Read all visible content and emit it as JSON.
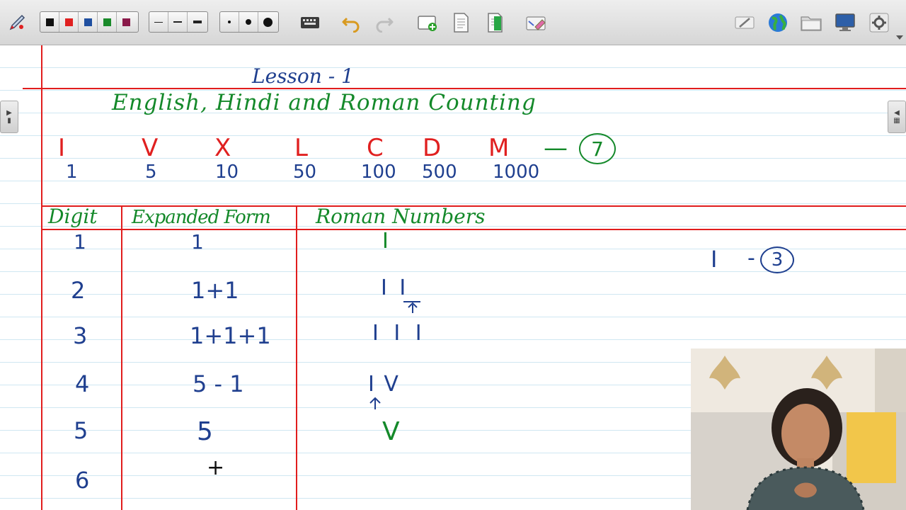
{
  "toolbar": {
    "colors": [
      "#111111",
      "#e02020",
      "#1f4fa0",
      "#1a8a2a",
      "#8a1a4a"
    ],
    "icons": [
      "pen-tool-icon",
      "keyboard-icon",
      "undo-icon",
      "redo-icon",
      "add-page-icon",
      "page-icon",
      "green-page-icon",
      "eraser-icon",
      "draw-icon",
      "globe-icon",
      "folder-icon",
      "monitor-icon",
      "settings-icon"
    ]
  },
  "lesson": {
    "title": "Lesson - 1",
    "subtitle": "English, Hindi and Roman Counting",
    "symbols": [
      "I",
      "V",
      "X",
      "L",
      "C",
      "D",
      "M"
    ],
    "values": [
      "1",
      "5",
      "10",
      "50",
      "100",
      "500",
      "1000"
    ],
    "count_dash": "—",
    "count": "7"
  },
  "table": {
    "headers": {
      "digit": "Digit",
      "expanded": "Expanded Form",
      "roman": "Roman Numbers"
    },
    "rows": [
      {
        "digit": "1",
        "expanded": "1",
        "roman": "I"
      },
      {
        "digit": "2",
        "expanded": "1+1",
        "roman": "I I"
      },
      {
        "digit": "3",
        "expanded": "1+1+1",
        "roman": "I I I"
      },
      {
        "digit": "4",
        "expanded": "5 - 1",
        "roman": "I V"
      },
      {
        "digit": "5",
        "expanded": "5",
        "roman": "V"
      },
      {
        "digit": "6",
        "expanded": "",
        "roman": ""
      }
    ]
  },
  "note": {
    "symbol": "I",
    "dash": "-",
    "count": "3"
  },
  "cursor": "+"
}
